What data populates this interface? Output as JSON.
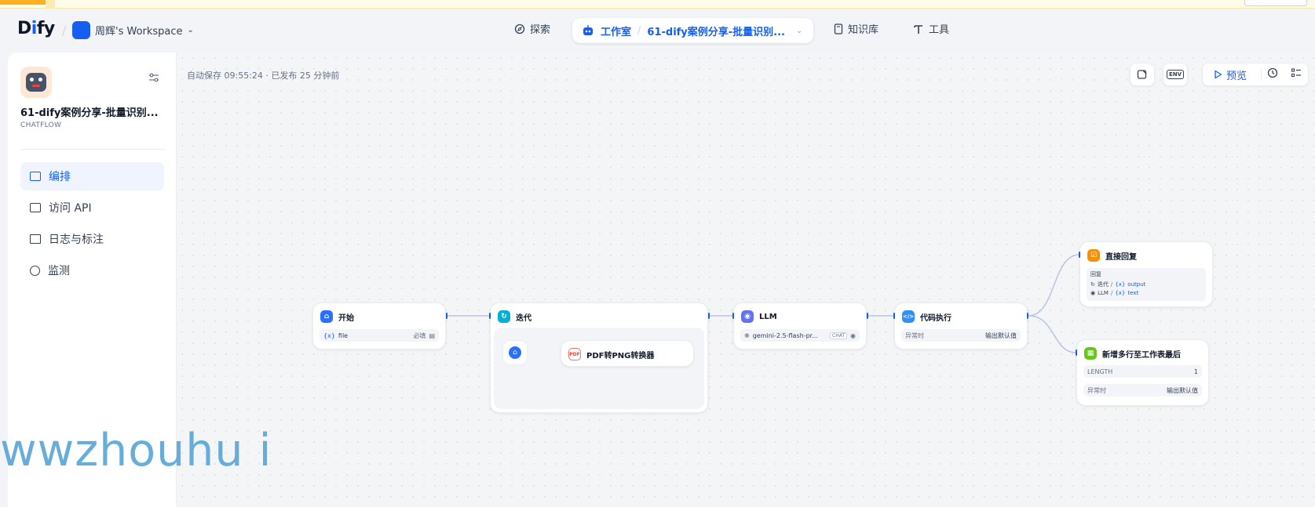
{
  "header": {
    "logo_prefix": "D",
    "logo_i": "i",
    "logo_suffix": "fy",
    "workspace": "周辉's Workspace",
    "nav": {
      "explore": "探索",
      "studio": "工作室",
      "app": "61-dify案例分享-批量识别...",
      "knowledge": "知识库",
      "tools": "工具"
    }
  },
  "sidebar": {
    "app_name": "61-dify案例分享-批量识别...",
    "app_type": "CHATFLOW",
    "items": [
      {
        "label": "编排",
        "icon": "layout-icon",
        "active": true
      },
      {
        "label": "访问 API",
        "icon": "terminal-icon",
        "active": false
      },
      {
        "label": "日志与标注",
        "icon": "log-icon",
        "active": false
      },
      {
        "label": "监测",
        "icon": "monitor-icon",
        "active": false
      }
    ]
  },
  "canvas": {
    "autosave": "自动保存 09:55:24 · 已发布 25 分钟前",
    "toolbar": {
      "env": "ENV",
      "preview": "预览"
    }
  },
  "nodes": {
    "start": {
      "title": "开始",
      "var": "file",
      "required": "必填"
    },
    "iteration": {
      "title": "迭代",
      "child": "PDF转PNG转换器"
    },
    "llm": {
      "title": "LLM",
      "model": "gemini-2.5-flash-pr...",
      "tag": "CHAT"
    },
    "code": {
      "title": "代码执行",
      "label": "异常时",
      "value": "输出默认值"
    },
    "answer": {
      "title": "直接回复",
      "label": "回复",
      "ref1_node": "迭代",
      "ref1_var": "output",
      "ref2_node": "LLM",
      "ref2_var": "text"
    },
    "append": {
      "title": "新增多行至工作表最后",
      "length_label": "LENGTH",
      "length_value": "1",
      "label": "异常时",
      "value": "输出默认值"
    }
  },
  "watermark": "wwzhouhu i",
  "colors": {
    "accent": "#155eef",
    "start": "#2970ff",
    "iteration": "#06aed4",
    "llm": "#6172f3",
    "code": "#2e90fa",
    "answer": "#f79009",
    "append": "#66c61c"
  }
}
